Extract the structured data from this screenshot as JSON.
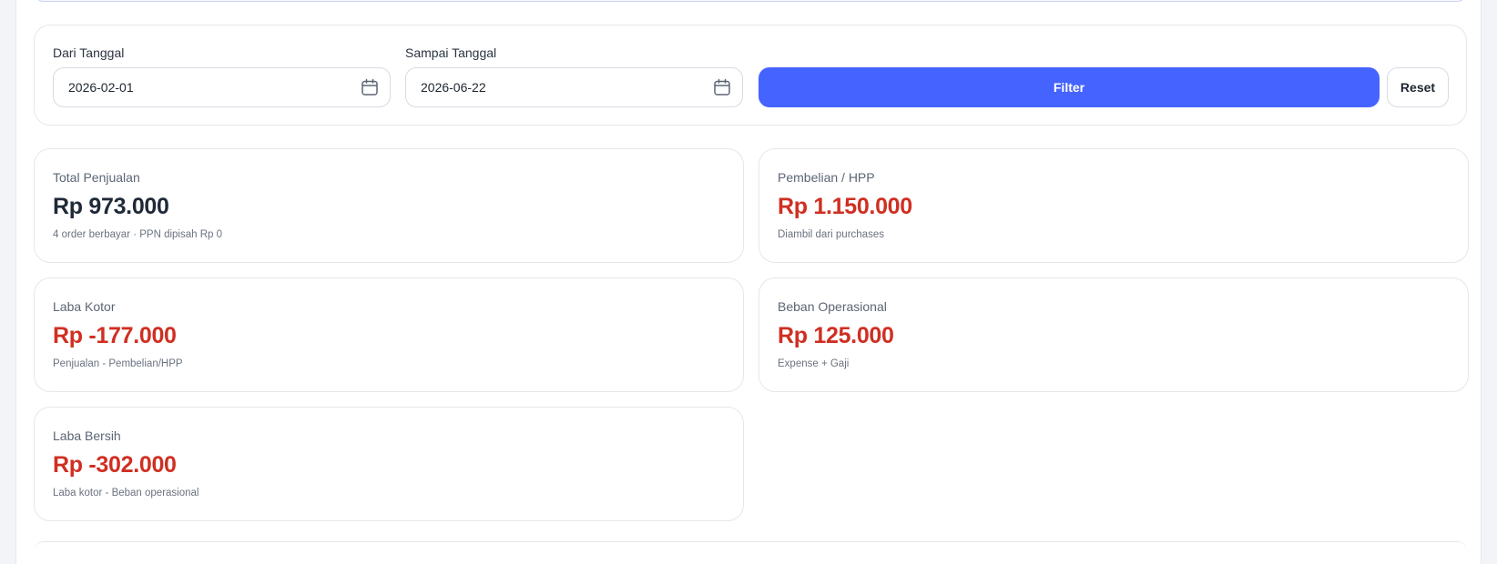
{
  "filter": {
    "from_label": "Dari Tanggal",
    "from_value": "2026-02-01",
    "to_label": "Sampai Tanggal",
    "to_value": "2026-06-22",
    "filter_button": "Filter",
    "reset_button": "Reset"
  },
  "stats": {
    "total_penjualan": {
      "label": "Total Penjualan",
      "value": "Rp 973.000",
      "note": "4 order berbayar · PPN dipisah Rp 0"
    },
    "pembelian_hpp": {
      "label": "Pembelian / HPP",
      "value": "Rp 1.150.000",
      "note": "Diambil dari purchases"
    },
    "laba_kotor": {
      "label": "Laba Kotor",
      "value": "Rp -177.000",
      "note": "Penjualan - Pembelian/HPP"
    },
    "beban_operasional": {
      "label": "Beban Operasional",
      "value": "Rp 125.000",
      "note": "Expense + Gaji"
    },
    "laba_bersih": {
      "label": "Laba Bersih",
      "value": "Rp -302.000",
      "note": "Laba kotor - Beban operasional"
    }
  },
  "colors": {
    "accent": "#4563ff",
    "negative": "#cf2f22",
    "neutral_value": "#1f2937"
  },
  "icons": {
    "date_picker": "calendar-icon"
  }
}
